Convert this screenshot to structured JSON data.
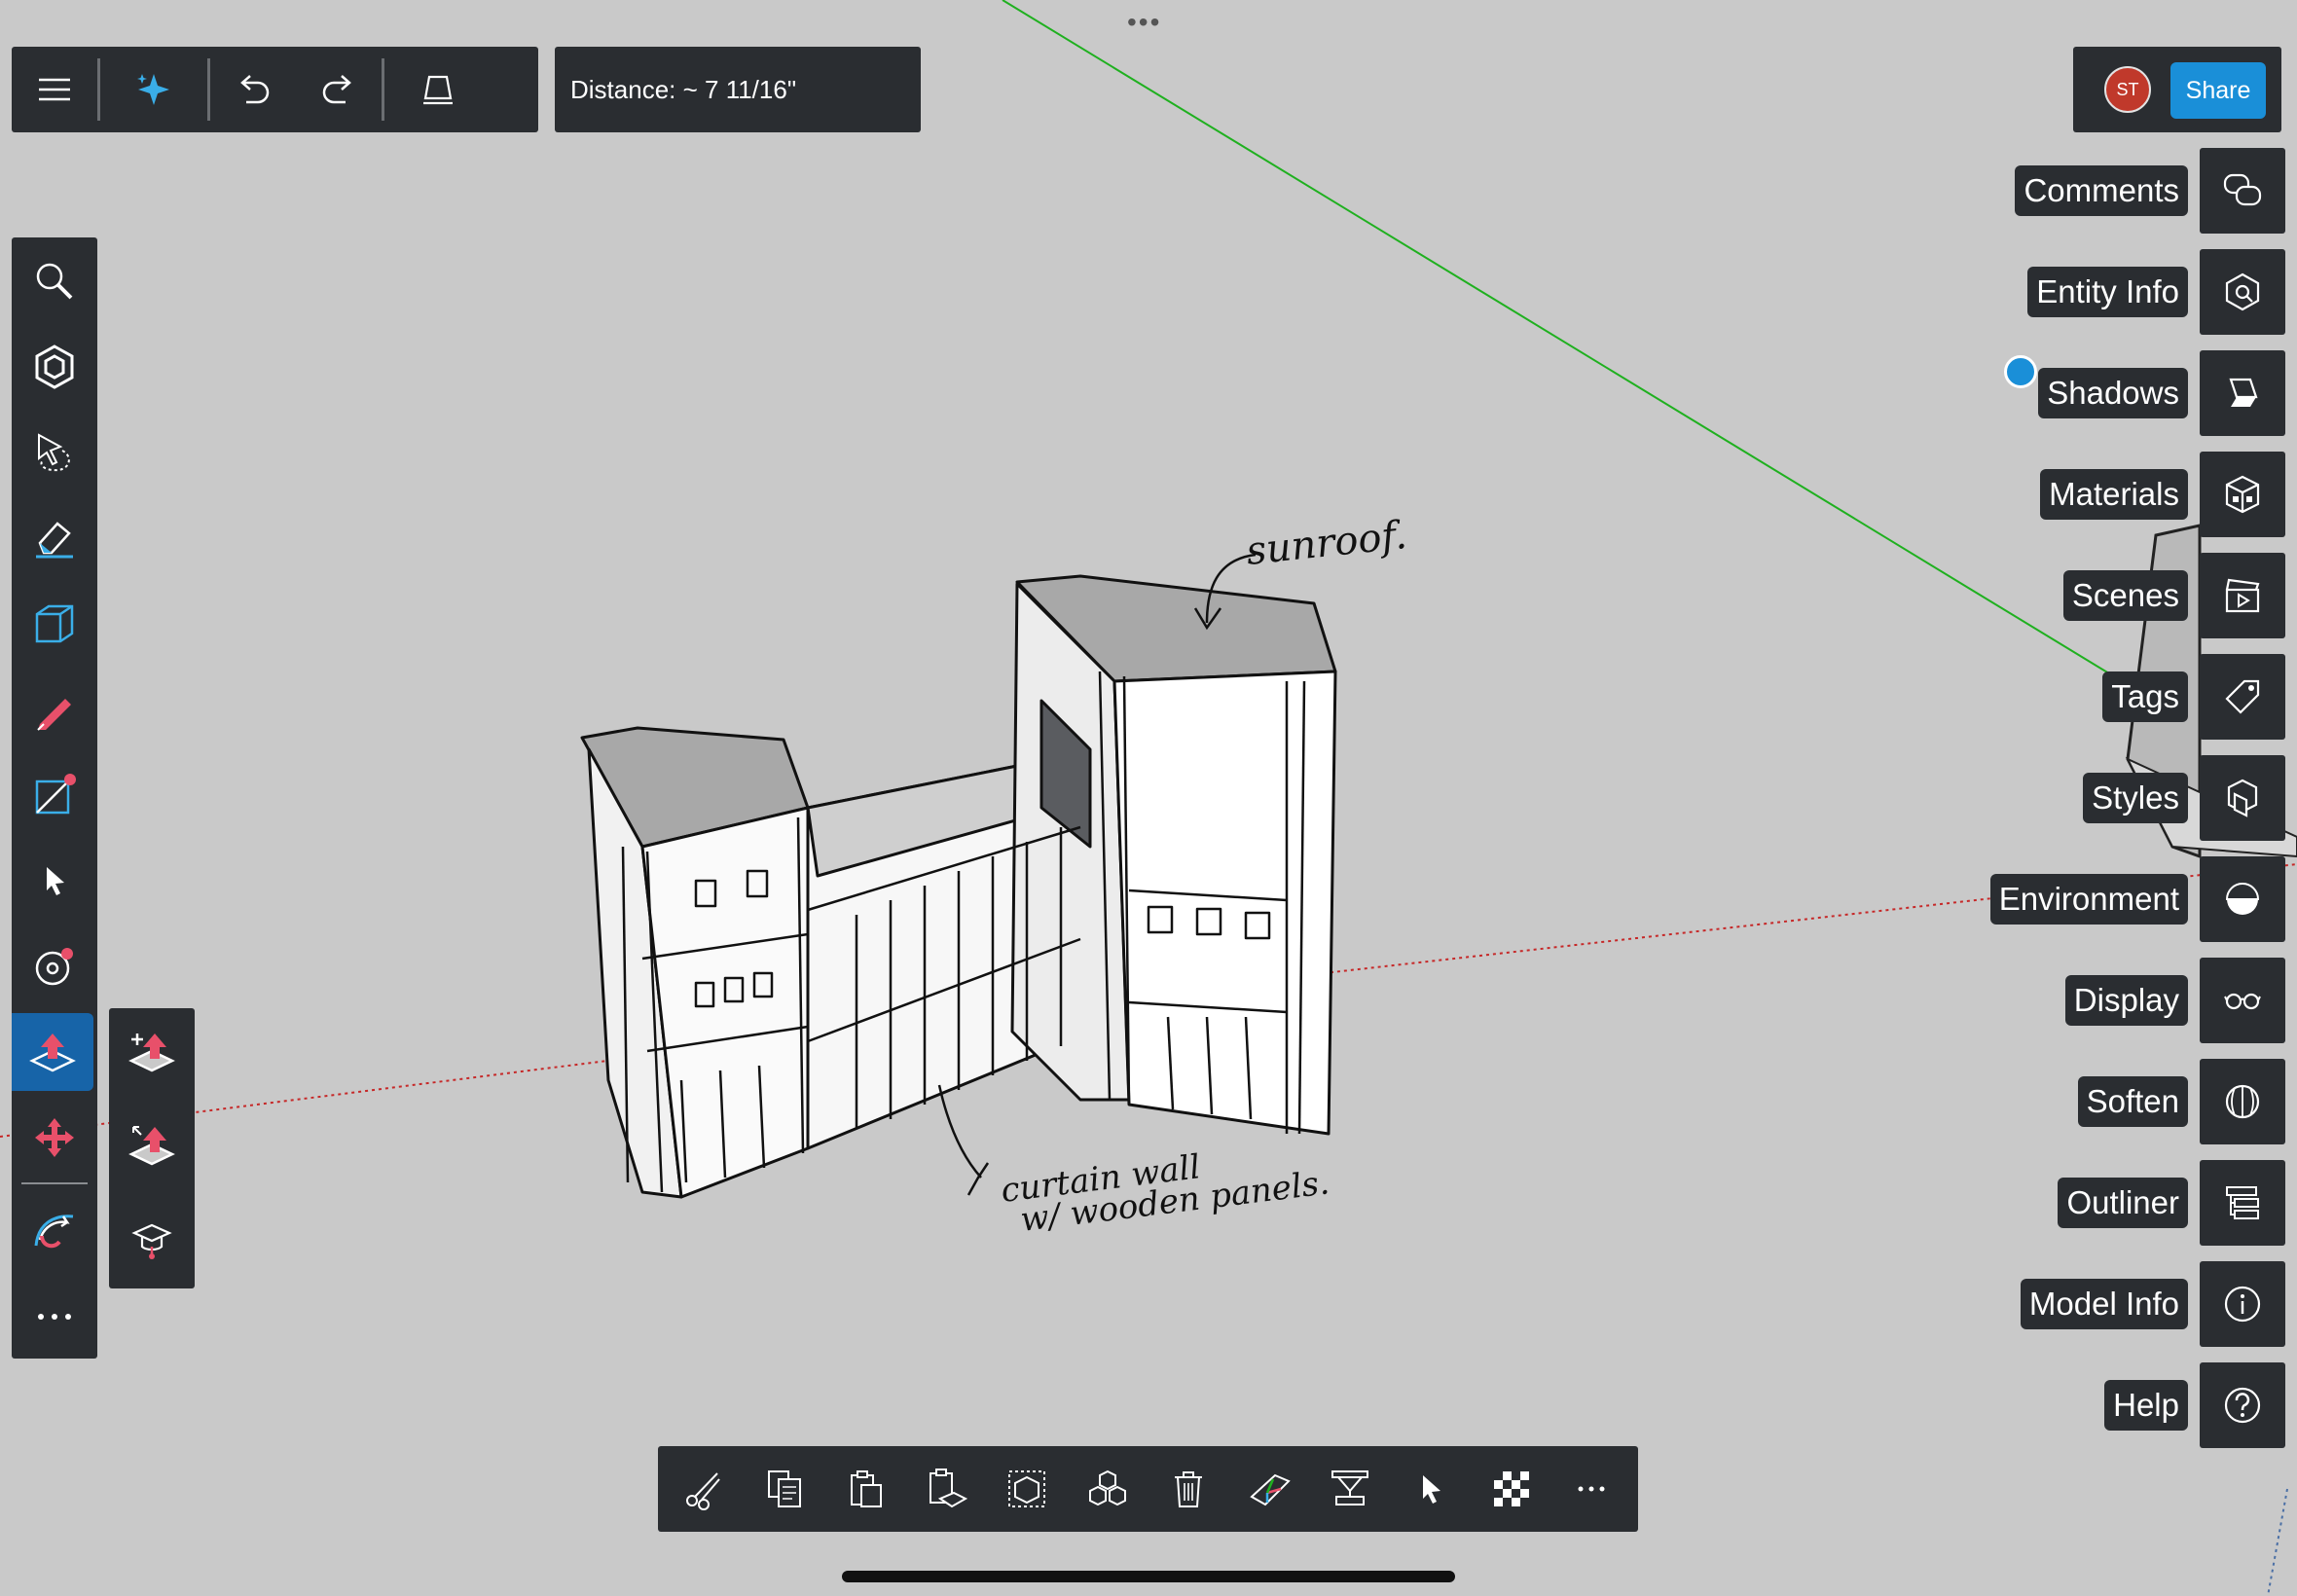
{
  "toolbar": {
    "distance_label": "Distance: ~ 7 11/16\""
  },
  "account": {
    "avatar_initials": "ST",
    "share_label": "Share"
  },
  "panels": [
    {
      "label": "Comments",
      "icon": "comments-icon"
    },
    {
      "label": "Entity Info",
      "icon": "entity-info-icon"
    },
    {
      "label": "Shadows",
      "icon": "shadows-icon"
    },
    {
      "label": "Materials",
      "icon": "materials-icon"
    },
    {
      "label": "Scenes",
      "icon": "scenes-icon"
    },
    {
      "label": "Tags",
      "icon": "tags-icon"
    },
    {
      "label": "Styles",
      "icon": "styles-icon"
    },
    {
      "label": "Environment",
      "icon": "environment-icon"
    },
    {
      "label": "Display",
      "icon": "display-icon"
    },
    {
      "label": "Soften",
      "icon": "soften-icon"
    },
    {
      "label": "Outliner",
      "icon": "outliner-icon"
    },
    {
      "label": "Model Info",
      "icon": "model-info-icon"
    },
    {
      "label": "Help",
      "icon": "help-icon"
    }
  ],
  "annotations": {
    "roof_note": "sunroof.",
    "wall_note_line1": "curtain wall",
    "wall_note_line2": "w/ wooden panels."
  },
  "colors": {
    "toolbar_bg": "#2a2d31",
    "accent_blue": "#1a8fd8",
    "active_tool": "#1764a8",
    "tool_red": "#e8506a",
    "green_axis": "#1fb01f",
    "red_axis": "#c62828",
    "canvas_bg": "#c9c9c9"
  }
}
